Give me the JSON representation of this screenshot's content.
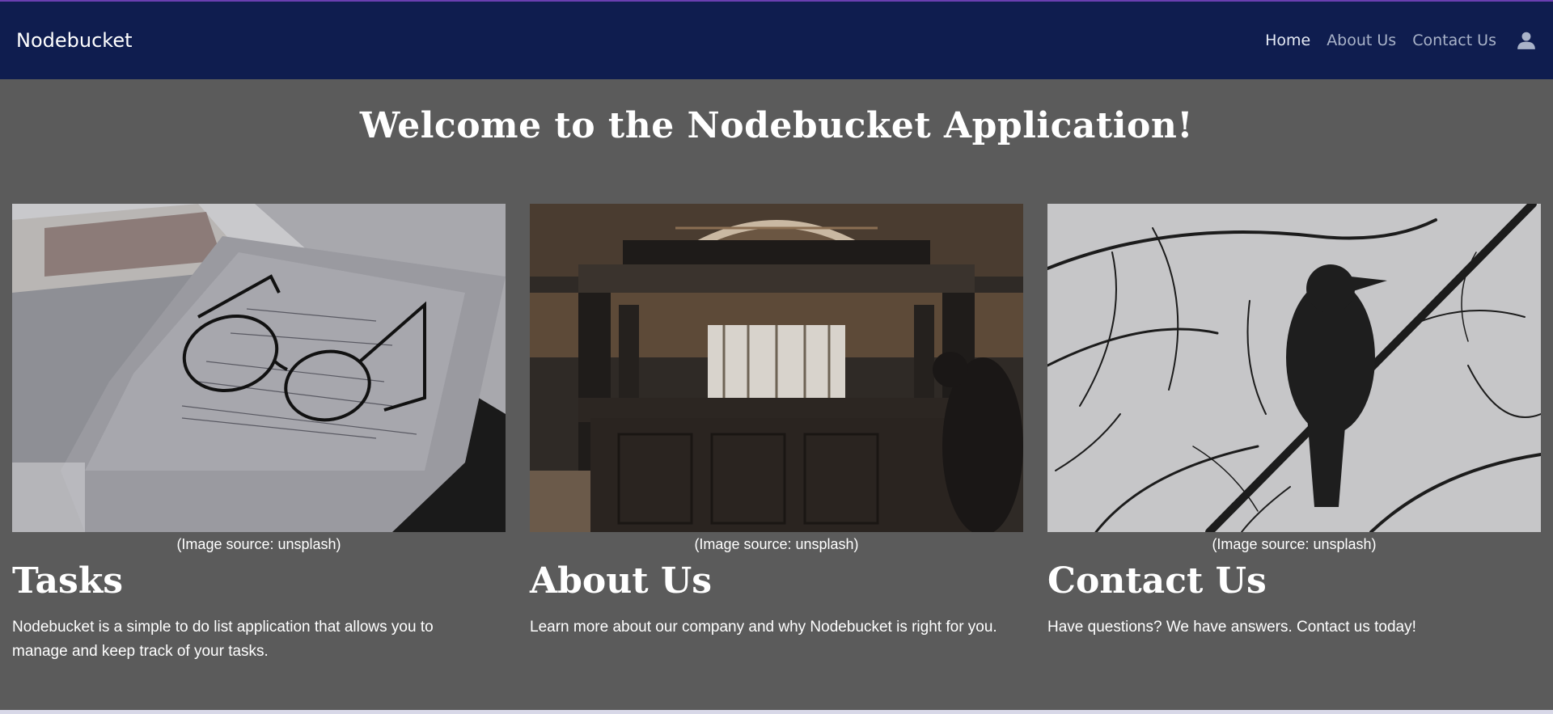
{
  "navbar": {
    "brand": "Nodebucket",
    "links": [
      "Home",
      "About Us",
      "Contact Us"
    ],
    "active_link": "Home"
  },
  "page": {
    "welcome": "Welcome to the Nodebucket Application!"
  },
  "cards": [
    {
      "caption": "(Image source: unsplash)",
      "title": "Tasks",
      "text": "Nodebucket is a simple to do list application that allows you to manage and keep track of your tasks."
    },
    {
      "caption": "(Image source: unsplash)",
      "title": "About Us",
      "text": "Learn more about our company and why Nodebucket is right for you."
    },
    {
      "caption": "(Image source: unsplash)",
      "title": "Contact Us",
      "text": "Have questions? We have answers. Contact us today!"
    }
  ],
  "icons": {
    "user": "user-icon"
  },
  "colors": {
    "navbar_bg": "#0f1d4f",
    "page_bg": "#5b5b5b",
    "text": "#ffffff"
  }
}
